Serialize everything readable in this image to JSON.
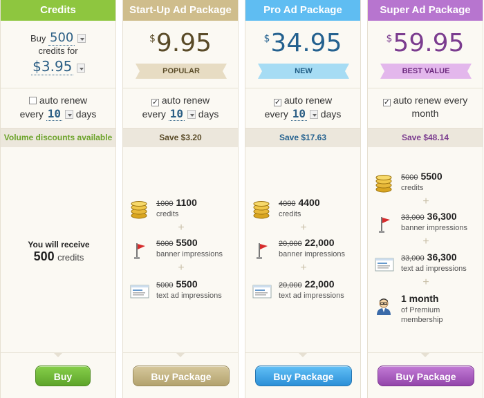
{
  "credits": {
    "header": "Credits",
    "buy_label": "Buy",
    "buy_amount": "500",
    "credits_for": "credits for",
    "price": "$3.95",
    "auto_renew": "auto renew",
    "every": "every",
    "days_value": "10",
    "days": "days",
    "strip": "Volume discounts available",
    "receive_label": "You will receive",
    "receive_amount": "500",
    "receive_unit": "credits",
    "button": "Buy"
  },
  "startup": {
    "header": "Start-Up Ad Package",
    "currency": "$",
    "price": "9.95",
    "ribbon": "POPULAR",
    "auto_renew": "auto renew",
    "every": "every",
    "days_value": "10",
    "days": "days",
    "strip": "Save $3.20",
    "items": [
      {
        "old": "1000",
        "new": "1100",
        "label": "credits"
      },
      {
        "old": "5000",
        "new": "5500",
        "label": "banner impressions"
      },
      {
        "old": "5000",
        "new": "5500",
        "label": "text ad impressions"
      }
    ],
    "button": "Buy Package"
  },
  "pro": {
    "header": "Pro Ad Package",
    "currency": "$",
    "price": "34.95",
    "ribbon": "NEW",
    "auto_renew": "auto renew",
    "every": "every",
    "days_value": "10",
    "days": "days",
    "strip": "Save $17.63",
    "items": [
      {
        "old": "4000",
        "new": "4400",
        "label": "credits"
      },
      {
        "old": "20,000",
        "new": "22,000",
        "label": "banner impressions"
      },
      {
        "old": "20,000",
        "new": "22,000",
        "label": "text ad impressions"
      }
    ],
    "button": "Buy Package"
  },
  "super": {
    "header": "Super Ad Package",
    "currency": "$",
    "price": "59.95",
    "ribbon": "BEST VALUE",
    "auto_renew": "auto renew every",
    "month": "month",
    "strip": "Save $48.14",
    "items": [
      {
        "old": "5000",
        "new": "5500",
        "label": "credits"
      },
      {
        "old": "33,000",
        "new": "36,300",
        "label": "banner impressions"
      },
      {
        "old": "33,000",
        "new": "36,300",
        "label": "text ad impressions"
      },
      {
        "old": "",
        "new": "1 month",
        "label": "of Premium membership"
      }
    ],
    "button": "Buy Package"
  },
  "plus": "+",
  "colors": {
    "credits": "#8ec63f",
    "startup": "#cfbd8c",
    "pro": "#5fbdf2",
    "super": "#b775cf",
    "credits_strip_text": "#6ca32a",
    "startup_strip_text": "#5a4b28",
    "pro_strip_text": "#24618f",
    "super_strip_text": "#7b3c8f"
  }
}
